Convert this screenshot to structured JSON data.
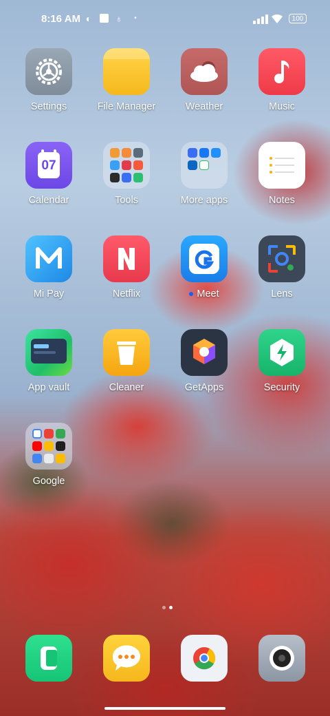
{
  "status_bar": {
    "time": "8:16 AM",
    "battery": "100"
  },
  "apps": {
    "settings": "Settings",
    "file_manager": "File Manager",
    "weather": "Weather",
    "music": "Music",
    "calendar": "Calendar",
    "calendar_day": "07",
    "tools": "Tools",
    "more_apps": "More apps",
    "notes": "Notes",
    "mi_pay": "Mi Pay",
    "netflix": "Netflix",
    "meet": "Meet",
    "lens": "Lens",
    "app_vault": "App vault",
    "cleaner": "Cleaner",
    "getapps": "GetApps",
    "security": "Security",
    "google": "Google"
  },
  "dock": {
    "items": [
      "phone-icon",
      "messages-icon",
      "chrome-icon",
      "camera-icon"
    ]
  },
  "page_indicator": {
    "current": 2,
    "total": 2
  }
}
